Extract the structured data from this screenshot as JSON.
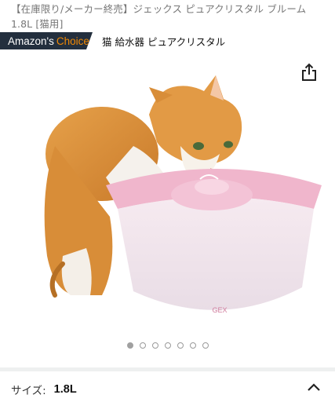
{
  "product": {
    "title": "【在庫限り/メーカー終売】ジェックス ピュアクリスタル ブルーム 1.8L [猫用]",
    "image_alt": "GEX ピュアクリスタル"
  },
  "badge": {
    "amazons": "Amazon's",
    "choice": "Choice",
    "keyword": "猫 給水器 ピュアクリスタル"
  },
  "icons": {
    "share": "share-icon",
    "chevron": "chevron-up-icon"
  },
  "carousel": {
    "total": 7,
    "active_index": 0
  },
  "size_selector": {
    "label": "サイズ:",
    "value": "1.8L"
  },
  "colors": {
    "badge_bg": "#232f3e",
    "badge_accent": "#f08804",
    "fountain_pink": "#f0b6cc"
  }
}
